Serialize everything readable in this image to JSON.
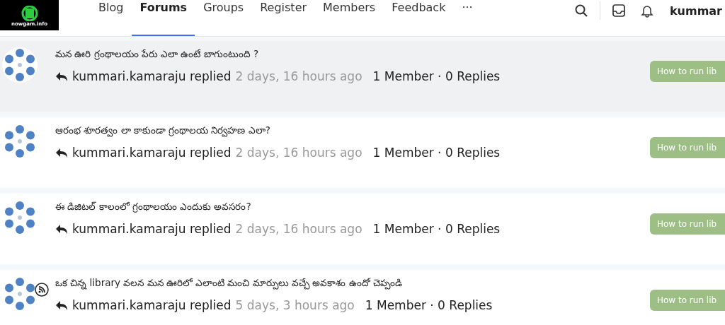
{
  "logo": {
    "text": "nowgam.info"
  },
  "nav": [
    {
      "label": "Blog",
      "selected": false
    },
    {
      "label": "Forums",
      "selected": true
    },
    {
      "label": "Groups",
      "selected": false
    },
    {
      "label": "Register",
      "selected": false
    },
    {
      "label": "Members",
      "selected": false
    },
    {
      "label": "Feedback",
      "selected": false
    },
    {
      "label": "···",
      "selected": false
    }
  ],
  "user": {
    "name": "kummar"
  },
  "topics": [
    {
      "title": "మన ఊరి గ్రంథాలయం పేరు ఎలా ఉంటే బాగుంటుంది ?",
      "author": "kummari.kamaraju replied",
      "time": "2 days, 16 hours ago",
      "stats": "1 Member · 0 Replies",
      "forum": "How to run lib",
      "highlighted": true,
      "feed": false
    },
    {
      "title": "ఆరంభ శూరత్వం లా కాకుండా గ్రంథాలయ నిర్వహణ ఎలా?",
      "author": "kummari.kamaraju replied",
      "time": "2 days, 16 hours ago",
      "stats": "1 Member · 0 Replies",
      "forum": "How to run lib",
      "highlighted": false,
      "feed": false
    },
    {
      "title": "ఈ డిజిటల్ కాలంలో గ్రంథాలయం ఎందుకు అవసరం?",
      "author": "kummari.kamaraju replied",
      "time": "2 days, 16 hours ago",
      "stats": "1 Member · 0 Replies",
      "forum": "How to run lib",
      "highlighted": false,
      "feed": false
    },
    {
      "title": "ఒక చిన్న library వలన మన ఊరిలో ఎలాంటి మంచి మార్పులు వచ్చే అవకాశం ఉందో చెప్పండి",
      "author": "kummari.kamaraju replied",
      "time": "5 days, 3 hours ago",
      "stats": "1 Member · 0 Replies",
      "forum": "How to run lib",
      "highlighted": false,
      "feed": true
    }
  ]
}
